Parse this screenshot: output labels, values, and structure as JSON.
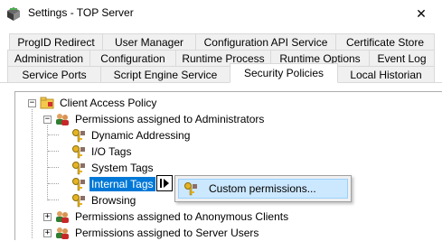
{
  "window": {
    "title": "Settings - TOP Server",
    "close_glyph": "✕"
  },
  "tabs": {
    "row1": [
      "ProgID Redirect",
      "User Manager",
      "Configuration API Service",
      "Certificate Store"
    ],
    "row2": [
      "Administration",
      "Configuration",
      "Runtime Process",
      "Runtime Options",
      "Event Log"
    ],
    "row3": [
      "Service Ports",
      "Script Engine Service",
      "Security Policies",
      "Local Historian"
    ],
    "active": "Security Policies"
  },
  "tree": {
    "root": "Client Access Policy",
    "admins": "Permissions assigned to Administrators",
    "children": [
      "Dynamic Addressing",
      "I/O Tags",
      "System Tags",
      "Internal Tags",
      "Browsing"
    ],
    "selected": "Internal Tags",
    "anonymous": "Permissions assigned to Anonymous Clients",
    "server_users": "Permissions assigned to Server Users",
    "expand_plus": "+",
    "expand_minus": "−"
  },
  "context_menu": {
    "item": "Custom permissions..."
  },
  "icons": {
    "app": "top-server-app-icon",
    "policy": "policy-folder-icon",
    "users": "user-group-icon",
    "permission": "key-permission-icon",
    "arrow": "pointer-arrow-icon"
  },
  "colors": {
    "selection": "#0078d7",
    "menu_highlight": "#cce8ff"
  }
}
